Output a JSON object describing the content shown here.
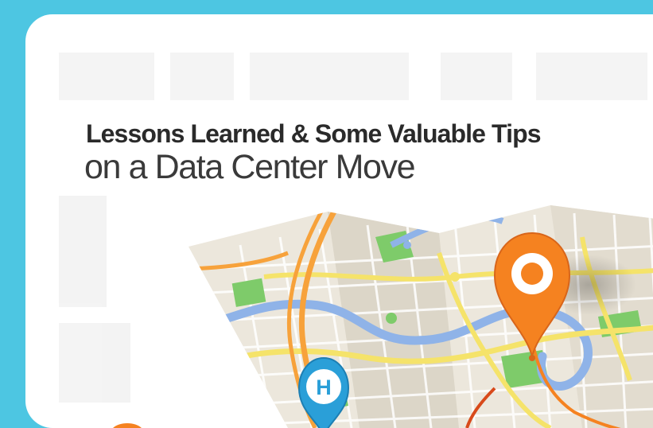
{
  "banner": {
    "title_bold": "Lessons Learned & Some Valuable Tips",
    "title_light": "on a Data Center Move"
  },
  "map": {
    "hospital_pin_letter": "H"
  },
  "icons": [
    "map-illustration",
    "hospital-pin-icon",
    "location-pin-icon"
  ],
  "colors": {
    "background": "#4dc6e2",
    "card": "#ffffff",
    "pin_orange": "#f58220",
    "pin_blue": "#2a9fd8",
    "road_yellow": "#f5e36a",
    "river_blue": "#8fb3e8",
    "park_green": "#7ecb6a"
  }
}
